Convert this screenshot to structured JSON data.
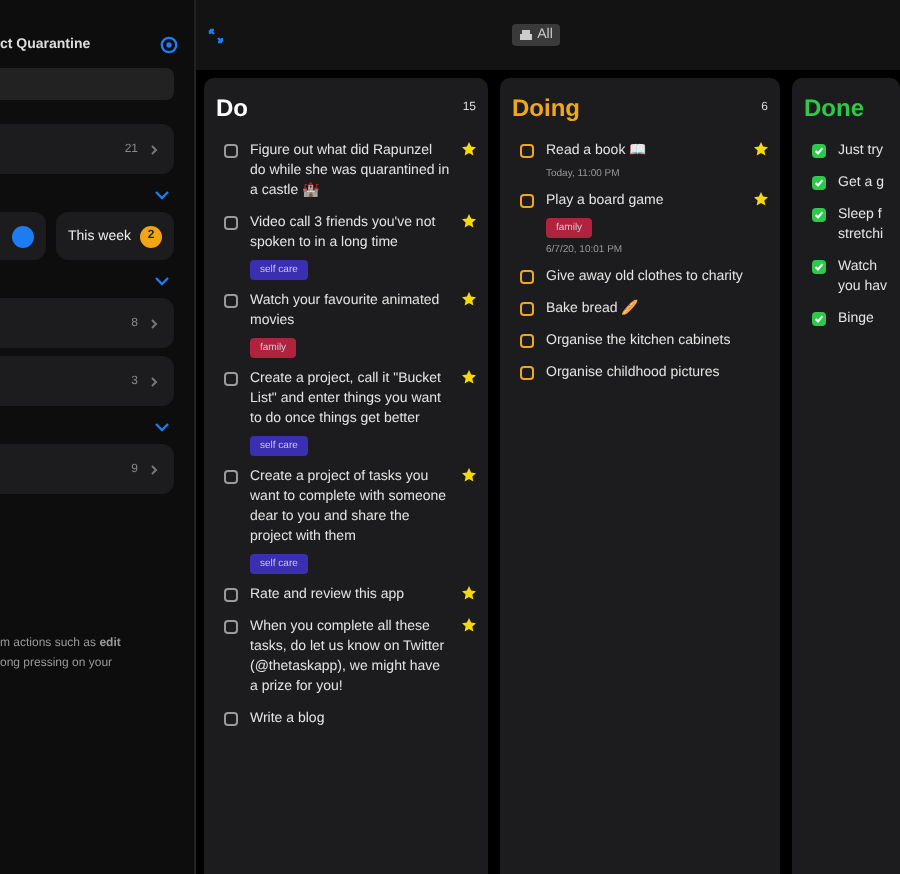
{
  "sidebar": {
    "title": "ct Quarantine",
    "sections": [
      {
        "kind": "row",
        "count": "21"
      },
      {
        "kind": "pills",
        "pills": [
          {
            "color": "#1e7cf2"
          },
          {
            "label": "This week",
            "badge": "2",
            "color": "#f2a516"
          }
        ]
      },
      {
        "kind": "row",
        "count": "8"
      },
      {
        "kind": "row",
        "count": "3"
      },
      {
        "kind": "row",
        "count": "9"
      }
    ],
    "hint": "m actions such as **edit**\nong pressing on your"
  },
  "toolbar": {
    "filter": "All"
  },
  "columns": [
    {
      "title": "Do",
      "count": "15",
      "color": "#ffffff",
      "items": [
        {
          "text": "Figure out what did Rapunzel do while she was quarantined in a castle 🏰",
          "starred": true,
          "done": false
        },
        {
          "text": "Video call 3 friends you've not spoken to in a long time",
          "starred": true,
          "done": false,
          "tag": {
            "label": "self care",
            "color": "#3a2fb0"
          }
        },
        {
          "text": "Watch your favourite animated movies",
          "starred": true,
          "done": false,
          "tag": {
            "label": "family",
            "color": "#b0233f"
          }
        },
        {
          "text": "Create a project, call it \"Bucket List\" and enter things you want to do once things get better",
          "starred": true,
          "done": false,
          "tag": {
            "label": "self care",
            "color": "#3a2fb0"
          }
        },
        {
          "text": "Create a project of tasks you want to complete with someone dear to you and share the project with them",
          "starred": true,
          "done": false,
          "tag": {
            "label": "self care",
            "color": "#3a2fb0"
          }
        },
        {
          "text": "Rate and review this app",
          "starred": true,
          "done": false
        },
        {
          "text": "When you complete all these tasks, do let us know on Twitter (@thetaskapp), we might have a prize for you!",
          "starred": true,
          "done": false
        },
        {
          "text": "Write a blog",
          "starred": false,
          "done": false
        }
      ]
    },
    {
      "title": "Doing",
      "count": "6",
      "color": "#f0a818",
      "items": [
        {
          "text": "Read a book 📖",
          "starred": true,
          "done": false,
          "date": "Today, 11:00 PM"
        },
        {
          "text": "Play a board game",
          "starred": true,
          "done": false,
          "tag": {
            "label": "family",
            "color": "#b0233f"
          },
          "date": "6/7/20, 10:01 PM"
        },
        {
          "text": "Give away old clothes to charity",
          "starred": false,
          "done": false
        },
        {
          "text": "Bake bread 🥖",
          "starred": false,
          "done": false
        },
        {
          "text": "Organise the kitchen cabinets",
          "starred": false,
          "done": false
        },
        {
          "text": "Organise childhood pictures",
          "starred": false,
          "done": false
        }
      ]
    },
    {
      "title": "Done",
      "color": "#2ec94a",
      "items": [
        {
          "text": "Just try",
          "done": true
        },
        {
          "text": "Get a g",
          "done": true
        },
        {
          "text": "Sleep f\nstretchi",
          "done": true
        },
        {
          "text": "Watch\nyou hav",
          "done": true
        },
        {
          "text": "Binge",
          "done": true
        }
      ]
    }
  ]
}
